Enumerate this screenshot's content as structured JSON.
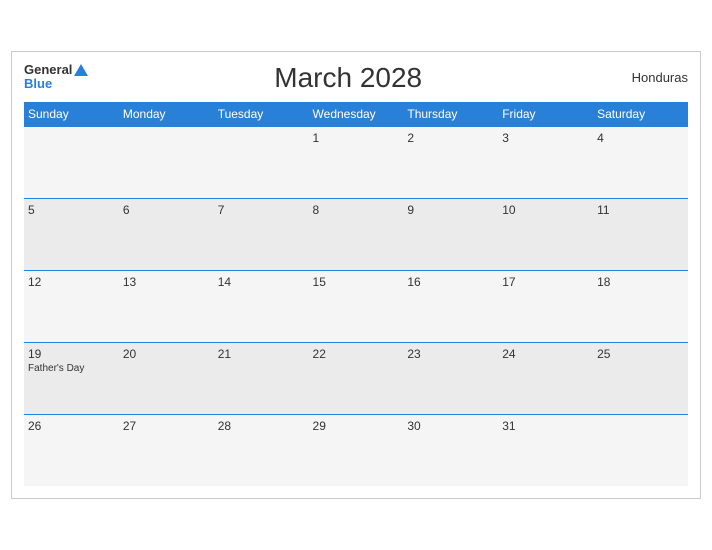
{
  "header": {
    "logo_general": "General",
    "logo_blue": "Blue",
    "title": "March 2028",
    "country": "Honduras"
  },
  "days_of_week": [
    "Sunday",
    "Monday",
    "Tuesday",
    "Wednesday",
    "Thursday",
    "Friday",
    "Saturday"
  ],
  "weeks": [
    [
      {
        "date": "",
        "event": ""
      },
      {
        "date": "",
        "event": ""
      },
      {
        "date": "",
        "event": ""
      },
      {
        "date": "1",
        "event": ""
      },
      {
        "date": "2",
        "event": ""
      },
      {
        "date": "3",
        "event": ""
      },
      {
        "date": "4",
        "event": ""
      }
    ],
    [
      {
        "date": "5",
        "event": ""
      },
      {
        "date": "6",
        "event": ""
      },
      {
        "date": "7",
        "event": ""
      },
      {
        "date": "8",
        "event": ""
      },
      {
        "date": "9",
        "event": ""
      },
      {
        "date": "10",
        "event": ""
      },
      {
        "date": "11",
        "event": ""
      }
    ],
    [
      {
        "date": "12",
        "event": ""
      },
      {
        "date": "13",
        "event": ""
      },
      {
        "date": "14",
        "event": ""
      },
      {
        "date": "15",
        "event": ""
      },
      {
        "date": "16",
        "event": ""
      },
      {
        "date": "17",
        "event": ""
      },
      {
        "date": "18",
        "event": ""
      }
    ],
    [
      {
        "date": "19",
        "event": "Father's Day"
      },
      {
        "date": "20",
        "event": ""
      },
      {
        "date": "21",
        "event": ""
      },
      {
        "date": "22",
        "event": ""
      },
      {
        "date": "23",
        "event": ""
      },
      {
        "date": "24",
        "event": ""
      },
      {
        "date": "25",
        "event": ""
      }
    ],
    [
      {
        "date": "26",
        "event": ""
      },
      {
        "date": "27",
        "event": ""
      },
      {
        "date": "28",
        "event": ""
      },
      {
        "date": "29",
        "event": ""
      },
      {
        "date": "30",
        "event": ""
      },
      {
        "date": "31",
        "event": ""
      },
      {
        "date": "",
        "event": ""
      }
    ]
  ]
}
